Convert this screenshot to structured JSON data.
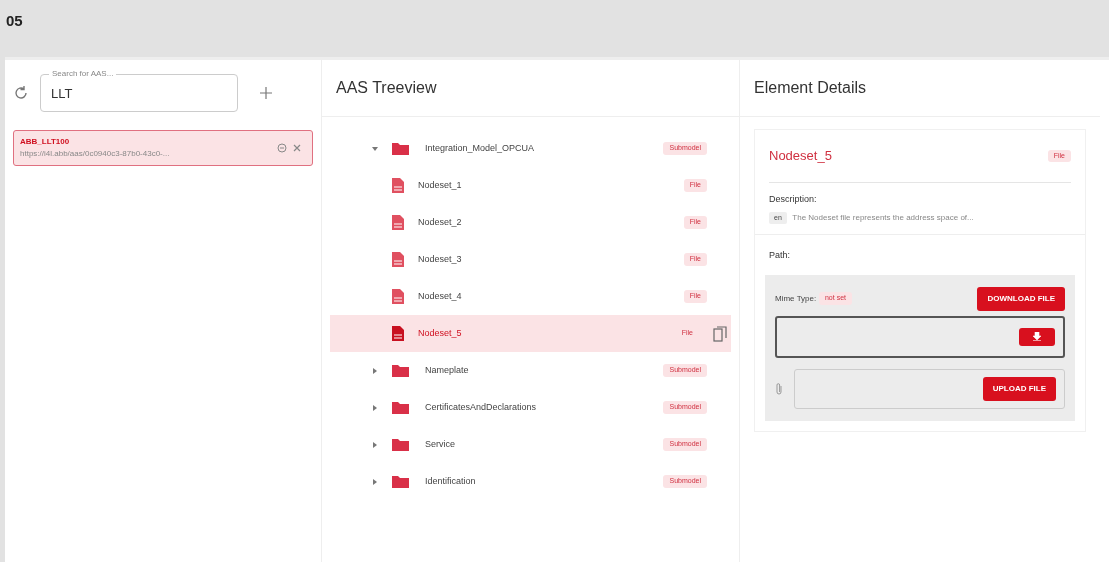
{
  "page_label": "05",
  "search": {
    "label": "Search for AAS...",
    "value": "LLT"
  },
  "aas_list": [
    {
      "name": "ABB_LLT100",
      "url": "https://i4l.abb/aas/0c0940c3-87b0-43c0-...",
      "selected": true
    }
  ],
  "treeview": {
    "title": "AAS Treeview",
    "nodes": [
      {
        "label": "Integration_Model_OPCUA",
        "badge": "Submodel",
        "kind": "submodel",
        "expanded": true,
        "selected": false,
        "children": [
          {
            "label": "Nodeset_1",
            "badge": "File",
            "kind": "file",
            "selected": false
          },
          {
            "label": "Nodeset_2",
            "badge": "File",
            "kind": "file",
            "selected": false
          },
          {
            "label": "Nodeset_3",
            "badge": "File",
            "kind": "file",
            "selected": false
          },
          {
            "label": "Nodeset_4",
            "badge": "File",
            "kind": "file",
            "selected": false
          },
          {
            "label": "Nodeset_5",
            "badge": "File",
            "kind": "file",
            "selected": true
          }
        ]
      },
      {
        "label": "Nameplate",
        "badge": "Submodel",
        "kind": "submodel",
        "expanded": false,
        "selected": false
      },
      {
        "label": "CertificatesAndDeclarations",
        "badge": "Submodel",
        "kind": "submodel",
        "expanded": false,
        "selected": false
      },
      {
        "label": "Service",
        "badge": "Submodel",
        "kind": "submodel",
        "expanded": false,
        "selected": false
      },
      {
        "label": "Identification",
        "badge": "Submodel",
        "kind": "submodel",
        "expanded": false,
        "selected": false
      }
    ]
  },
  "details": {
    "title": "Element Details",
    "element_name": "Nodeset_5",
    "element_badge": "File",
    "description_label": "Description:",
    "description_lang": "en",
    "description_text": "The Nodeset file represents the address space of...",
    "path_label": "Path:",
    "mime_label": "Mime Type:",
    "mime_value": "not set",
    "download_button": "DOWNLOAD FILE",
    "upload_button": "UPLOAD FILE"
  }
}
